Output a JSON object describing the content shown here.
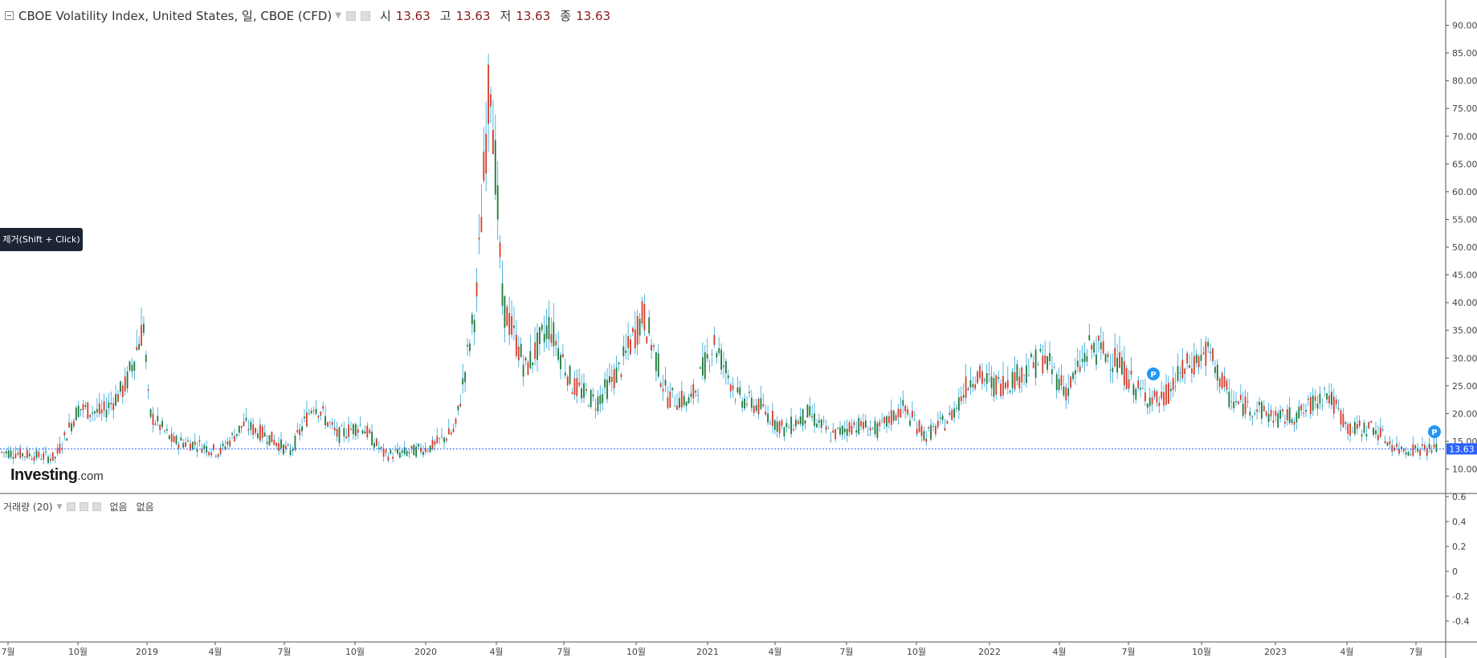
{
  "header": {
    "symbol": "CBOE Volatility Index, United States, 일, CBOE (CFD)",
    "open_label": "시",
    "open": "13.63",
    "high_label": "고",
    "high": "13.63",
    "low_label": "저",
    "low": "13.63",
    "close_label": "종",
    "close": "13.63"
  },
  "volume_pane": {
    "label": "거래량 (20)",
    "value1": "없음",
    "value2": "없음"
  },
  "tooltip": {
    "text": "제거(Shift + Click)"
  },
  "logo": {
    "main": "Investing",
    "suffix": ".com"
  },
  "colors": {
    "up": "#1f7a3c",
    "down": "#d63c2a",
    "wick": "#2aa3d6",
    "last_price_line": "#2962ff",
    "last_price_tag": "#2962ff",
    "marker": "#2196f3"
  },
  "chart_data": {
    "type": "candlestick",
    "ylim": [
      8.5,
      91.5
    ],
    "y_ticks": [
      "90.00",
      "85.00",
      "80.00",
      "75.00",
      "70.00",
      "65.00",
      "60.00",
      "55.00",
      "50.00",
      "45.00",
      "40.00",
      "35.00",
      "30.00",
      "25.00",
      "20.00",
      "15.00",
      "10.00"
    ],
    "x_ticks": [
      "7월",
      "10월",
      "2019",
      "4월",
      "7월",
      "10월",
      "2020",
      "4월",
      "7월",
      "10월",
      "2021",
      "4월",
      "7월",
      "10월",
      "2022",
      "4월",
      "7월",
      "10월",
      "2023",
      "4월",
      "7월"
    ],
    "last_price": 13.63,
    "last_price_label": "13.63",
    "marker_label": "P",
    "series": [
      {
        "date": "2018-07",
        "close": 13
      },
      {
        "date": "2018-08",
        "close": 12.5
      },
      {
        "date": "2018-09",
        "close": 12
      },
      {
        "date": "2018-10",
        "close": 21
      },
      {
        "date": "2018-11",
        "close": 20
      },
      {
        "date": "2018-12",
        "close": 25
      },
      {
        "date": "2018-12-24",
        "close": 36
      },
      {
        "date": "2019-01",
        "close": 20
      },
      {
        "date": "2019-02",
        "close": 15
      },
      {
        "date": "2019-03",
        "close": 14.5
      },
      {
        "date": "2019-04",
        "close": 13
      },
      {
        "date": "2019-05",
        "close": 18
      },
      {
        "date": "2019-06",
        "close": 16
      },
      {
        "date": "2019-07",
        "close": 13
      },
      {
        "date": "2019-08",
        "close": 22
      },
      {
        "date": "2019-09",
        "close": 16
      },
      {
        "date": "2019-10",
        "close": 18
      },
      {
        "date": "2019-11",
        "close": 12.5
      },
      {
        "date": "2019-12",
        "close": 13
      },
      {
        "date": "2020-01",
        "close": 14
      },
      {
        "date": "2020-02",
        "close": 17
      },
      {
        "date": "2020-02-28",
        "close": 40
      },
      {
        "date": "2020-03-16",
        "close": 82.7
      },
      {
        "date": "2020-04",
        "close": 40
      },
      {
        "date": "2020-05",
        "close": 28
      },
      {
        "date": "2020-06",
        "close": 36
      },
      {
        "date": "2020-07",
        "close": 25
      },
      {
        "date": "2020-08",
        "close": 22
      },
      {
        "date": "2020-09",
        "close": 28
      },
      {
        "date": "2020-10",
        "close": 38
      },
      {
        "date": "2020-11",
        "close": 23
      },
      {
        "date": "2020-12",
        "close": 22
      },
      {
        "date": "2021-01",
        "close": 33
      },
      {
        "date": "2021-02",
        "close": 23
      },
      {
        "date": "2021-03",
        "close": 21
      },
      {
        "date": "2021-04",
        "close": 17
      },
      {
        "date": "2021-05",
        "close": 20
      },
      {
        "date": "2021-06",
        "close": 16
      },
      {
        "date": "2021-07",
        "close": 18
      },
      {
        "date": "2021-08",
        "close": 17
      },
      {
        "date": "2021-09",
        "close": 21
      },
      {
        "date": "2021-10",
        "close": 16
      },
      {
        "date": "2021-11",
        "close": 19
      },
      {
        "date": "2021-12",
        "close": 27
      },
      {
        "date": "2022-01",
        "close": 25
      },
      {
        "date": "2022-02",
        "close": 27
      },
      {
        "date": "2022-03",
        "close": 30
      },
      {
        "date": "2022-04",
        "close": 24
      },
      {
        "date": "2022-05",
        "close": 32
      },
      {
        "date": "2022-06",
        "close": 30
      },
      {
        "date": "2022-07",
        "close": 24
      },
      {
        "date": "2022-08",
        "close": 22
      },
      {
        "date": "2022-09",
        "close": 28
      },
      {
        "date": "2022-10",
        "close": 31
      },
      {
        "date": "2022-11",
        "close": 22
      },
      {
        "date": "2022-12",
        "close": 21
      },
      {
        "date": "2023-01",
        "close": 19
      },
      {
        "date": "2023-02",
        "close": 20
      },
      {
        "date": "2023-03",
        "close": 24
      },
      {
        "date": "2023-04",
        "close": 17
      },
      {
        "date": "2023-05",
        "close": 17.5
      },
      {
        "date": "2023-06",
        "close": 13.5
      },
      {
        "date": "2023-07",
        "close": 13.6
      }
    ],
    "volume_pane": {
      "y_ticks": [
        "0.6",
        "0.4",
        "0.2",
        "0",
        "-0.2",
        "-0.4"
      ]
    }
  }
}
